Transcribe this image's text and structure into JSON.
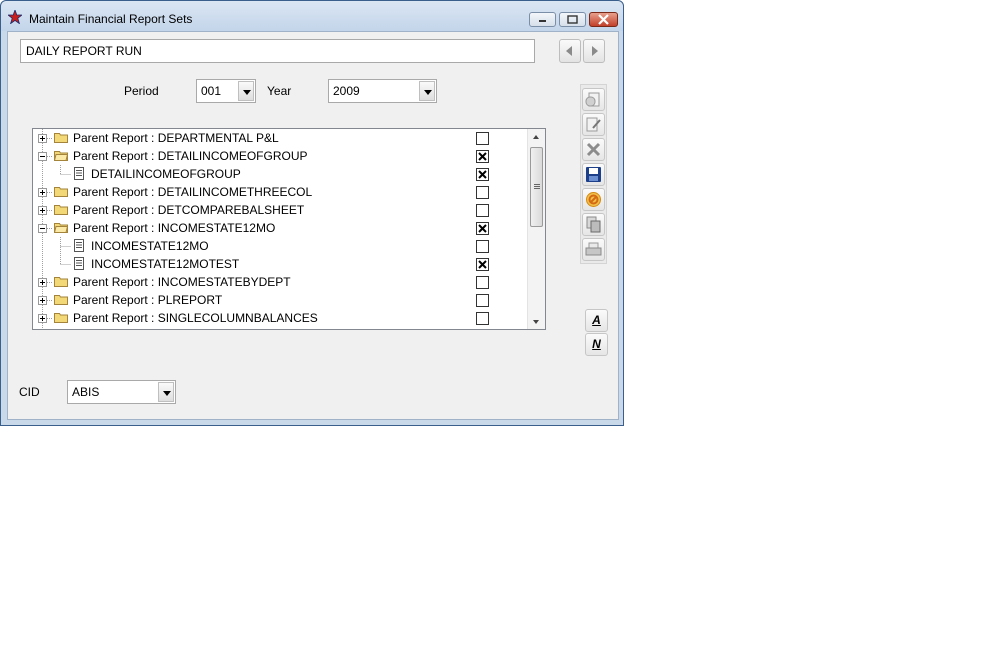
{
  "window": {
    "title": "Maintain Financial Report Sets"
  },
  "report_name": "DAILY REPORT RUN",
  "period": {
    "label": "Period",
    "value": "001"
  },
  "year": {
    "label": "Year",
    "value": "2009"
  },
  "cid": {
    "label": "CID",
    "value": "ABIS"
  },
  "tree": {
    "rows": [
      {
        "text": "Parent Report : DEPARTMENTAL P&L",
        "type": "parent",
        "expanded": false,
        "checked": false
      },
      {
        "text": "Parent Report : DETAILINCOMEOFGROUP",
        "type": "parent",
        "expanded": true,
        "checked": true
      },
      {
        "text": "DETAILINCOMEOFGROUP",
        "type": "child",
        "checked": true
      },
      {
        "text": "Parent Report : DETAILINCOMETHREECOL",
        "type": "parent",
        "expanded": false,
        "checked": false
      },
      {
        "text": "Parent Report : DETCOMPAREBALSHEET",
        "type": "parent",
        "expanded": false,
        "checked": false
      },
      {
        "text": "Parent Report : INCOMESTATE12MO",
        "type": "parent",
        "expanded": true,
        "checked": true
      },
      {
        "text": "INCOMESTATE12MO",
        "type": "child",
        "checked": false
      },
      {
        "text": "INCOMESTATE12MOTEST",
        "type": "child",
        "checked": true
      },
      {
        "text": "Parent Report : INCOMESTATEBYDEPT",
        "type": "parent",
        "expanded": false,
        "checked": false
      },
      {
        "text": "Parent Report : PLREPORT",
        "type": "parent",
        "expanded": false,
        "checked": false
      },
      {
        "text": "Parent Report : SINGLECOLUMNBALANCES",
        "type": "parent",
        "expanded": false,
        "checked": false
      }
    ]
  },
  "side_buttons": {
    "a_label": "A",
    "n_label": "N"
  },
  "colors": {
    "title_bar": "#c9d9ea",
    "close_button": "#c2402a",
    "folder": "#f3d878",
    "save_icon": "#1d3f8a",
    "cancel_icon": "#e8a020"
  }
}
